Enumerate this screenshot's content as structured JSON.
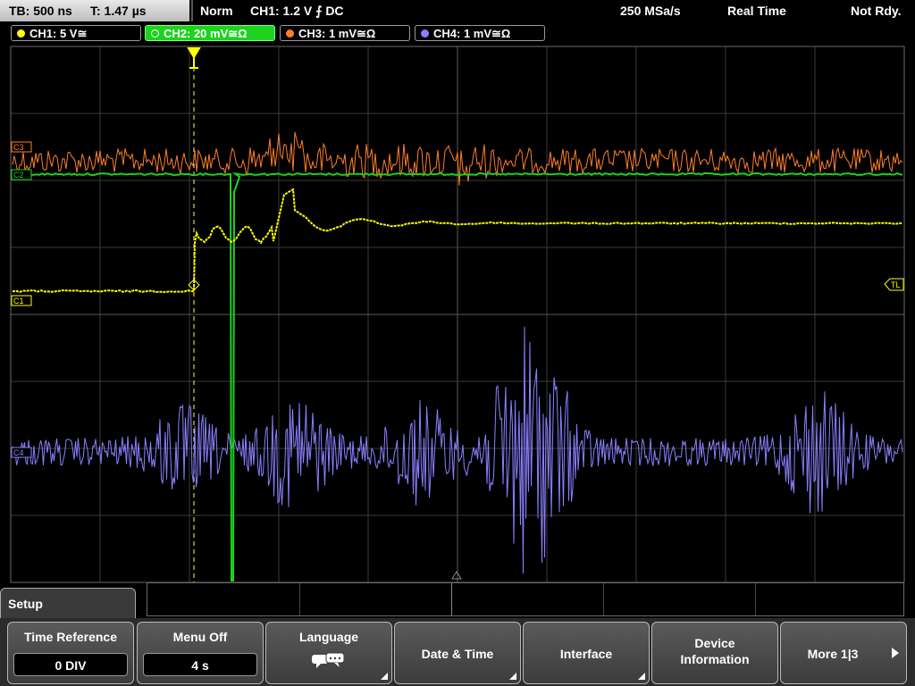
{
  "status": {
    "timebase": "TB: 500 ns",
    "trigger_time": "T: 1.47 µs",
    "mode": "Norm",
    "trigger": "CH1: 1.2 V ⨍ DC",
    "sample_rate": "250 MSa/s",
    "acq_mode": "Real Time",
    "state": "Not Rdy."
  },
  "channels": [
    {
      "label": "CH1: 5 V≅",
      "color": "#ffff00"
    },
    {
      "label": "CH2: 20 mV≅Ω",
      "color": "#00dd00"
    },
    {
      "label": "CH3: 1 mV≅Ω",
      "color": "#ff7f27"
    },
    {
      "label": "CH4: 1 mV≅Ω",
      "color": "#8a80ff"
    }
  ],
  "markers": {
    "c3": "C3",
    "c2": "C2",
    "c1": "C1",
    "c4": "C4",
    "trigger_level": "TL"
  },
  "menu": {
    "title": "Setup",
    "keys": [
      {
        "label": "Time Reference",
        "value": "0 DIV"
      },
      {
        "label": "Menu Off",
        "value": "4 s"
      },
      {
        "label": "Language",
        "icon": "speech-bubble-icon"
      },
      {
        "label": "Date & Time"
      },
      {
        "label": "Interface"
      },
      {
        "label": "Device Information"
      },
      {
        "label": "More 1|3"
      }
    ]
  }
}
